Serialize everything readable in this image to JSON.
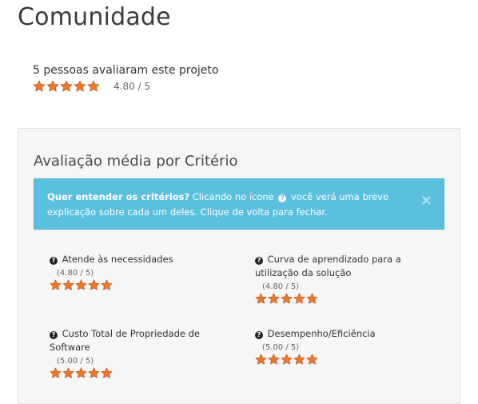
{
  "page": {
    "title": "Comunidade"
  },
  "summary": {
    "text": "5 pessoas avaliaram este projeto",
    "score": "4.80 / 5",
    "rating": 4.8,
    "max": 5
  },
  "colors": {
    "star": "#f07a2b",
    "star_stroke": "#c4521a",
    "alert_bg": "#5bc0de"
  },
  "panel": {
    "title": "Avaliação média por Critério",
    "alert": {
      "lead": "Quer entender os critérios?",
      "text_before_icon": " Clicando no ícone ",
      "icon": "question-circle-icon",
      "text_after_icon": " você verá uma breve explicação sobre cada um deles. Clique de volta para fechar.",
      "close": "×"
    }
  },
  "criteria": [
    {
      "label": "Atende às necessidades",
      "score": "(4.80 / 5)",
      "rating": 4.8
    },
    {
      "label": "Curva de aprendizado para a utilização da solução",
      "score": "(4.80 / 5)",
      "rating": 4.8
    },
    {
      "label": "Custo Total de Propriedade de Software",
      "score": "(5.00 / 5)",
      "rating": 5.0
    },
    {
      "label": "Desempenho/Eficiência",
      "score": "(5.00 / 5)",
      "rating": 5.0
    }
  ]
}
